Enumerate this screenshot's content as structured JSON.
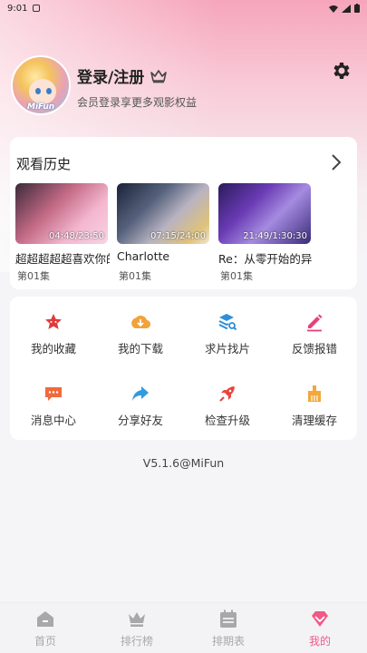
{
  "status_bar": {
    "time": "9:01"
  },
  "header": {
    "login_title": "登录/注册",
    "subtitle": "会员登录享更多观影权益",
    "avatar_text": "MiFun"
  },
  "history": {
    "title": "观看历史",
    "items": [
      {
        "title": "超超超超超喜欢你的",
        "duration": "04:48/23:50",
        "episode": "第01集"
      },
      {
        "title": "Charlotte",
        "duration": "07:15/24:00",
        "episode": "第01集"
      },
      {
        "title": "Re：从零开始的异世界生活",
        "duration": "21:49/1:30:30",
        "episode": "第01集"
      }
    ]
  },
  "grid": {
    "items": [
      {
        "label": "我的收藏",
        "icon": "star-icon",
        "color": "#e23a3a"
      },
      {
        "label": "我的下载",
        "icon": "download-icon",
        "color": "#f2a23a"
      },
      {
        "label": "求片找片",
        "icon": "search-stack-icon",
        "color": "#2f8fd8"
      },
      {
        "label": "反馈报错",
        "icon": "edit-icon",
        "color": "#e8407a"
      },
      {
        "label": "消息中心",
        "icon": "message-icon",
        "color": "#f06a3a"
      },
      {
        "label": "分享好友",
        "icon": "share-icon",
        "color": "#2f9be0"
      },
      {
        "label": "检查升级",
        "icon": "rocket-icon",
        "color": "#e8453a"
      },
      {
        "label": "清理缓存",
        "icon": "broom-icon",
        "color": "#f2a83a"
      }
    ]
  },
  "version": "V5.1.6@MiFun",
  "nav": {
    "items": [
      {
        "label": "首页",
        "icon": "home-icon"
      },
      {
        "label": "排行榜",
        "icon": "crown-icon"
      },
      {
        "label": "排期表",
        "icon": "calendar-icon"
      },
      {
        "label": "我的",
        "icon": "heart-gem-icon",
        "active": true
      }
    ],
    "active_color": "#ef5a86",
    "inactive_color": "#a8a8ab"
  }
}
